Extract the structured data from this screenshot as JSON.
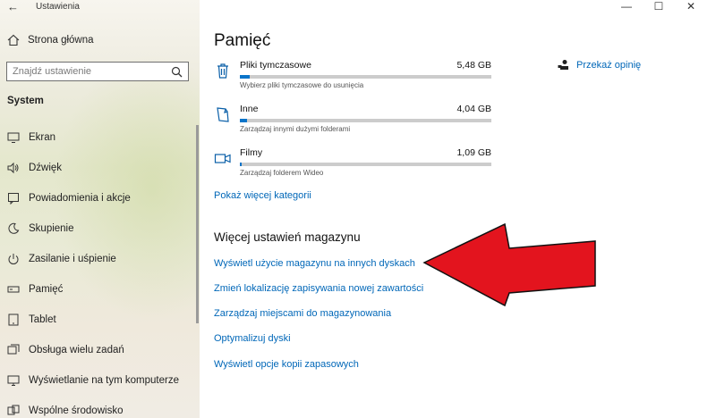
{
  "window": {
    "title": "Ustawienia",
    "back_icon": "back-arrow-icon",
    "minimize": "—",
    "maximize": "☐",
    "close": "✕"
  },
  "sidebar": {
    "home_label": "Strona główna",
    "search_placeholder": "Znajdź ustawienie",
    "section_title": "System",
    "items": [
      {
        "label": "Ekran",
        "icon": "display-icon"
      },
      {
        "label": "Dźwięk",
        "icon": "speaker-icon"
      },
      {
        "label": "Powiadomienia i akcje",
        "icon": "notifications-icon"
      },
      {
        "label": "Skupienie",
        "icon": "focus-moon-icon"
      },
      {
        "label": "Zasilanie i uśpienie",
        "icon": "power-icon"
      },
      {
        "label": "Pamięć",
        "icon": "storage-icon"
      },
      {
        "label": "Tablet",
        "icon": "tablet-icon"
      },
      {
        "label": "Obsługa wielu zadań",
        "icon": "multitasking-icon"
      },
      {
        "label": "Wyświetlanie na tym komputerze",
        "icon": "projecting-icon"
      },
      {
        "label": "Wspólne środowisko",
        "icon": "shared-experiences-icon"
      }
    ]
  },
  "main": {
    "title": "Pamięć",
    "storage_items": [
      {
        "name": "Pliki tymczasowe",
        "size": "5,48 GB",
        "desc": "Wybierz pliki tymczasowe do usunięcia",
        "usage_fraction": 0.04,
        "icon": "trash-icon"
      },
      {
        "name": "Inne",
        "size": "4,04 GB",
        "desc": "Zarządzaj innymi dużymi folderami",
        "usage_fraction": 0.03,
        "icon": "other-files-icon"
      },
      {
        "name": "Filmy",
        "size": "1,09 GB",
        "desc": "Zarządzaj folderem Wideo",
        "usage_fraction": 0.008,
        "icon": "video-icon"
      }
    ],
    "show_more": "Pokaż więcej kategorii",
    "more_settings_title": "Więcej ustawień magazynu",
    "links": [
      "Wyświetl użycie magazynu na innych dyskach",
      "Zmień lokalizację zapisywania nowej zawartości",
      "Zarządzaj miejscami do magazynowania",
      "Optymalizuj dyski",
      "Wyświetl opcje kopii zapasowych"
    ],
    "feedback": "Przekaż opinię"
  },
  "colors": {
    "accent": "#0067b8",
    "bar_fill": "#0a74c9",
    "arrow": "#e3141e"
  }
}
